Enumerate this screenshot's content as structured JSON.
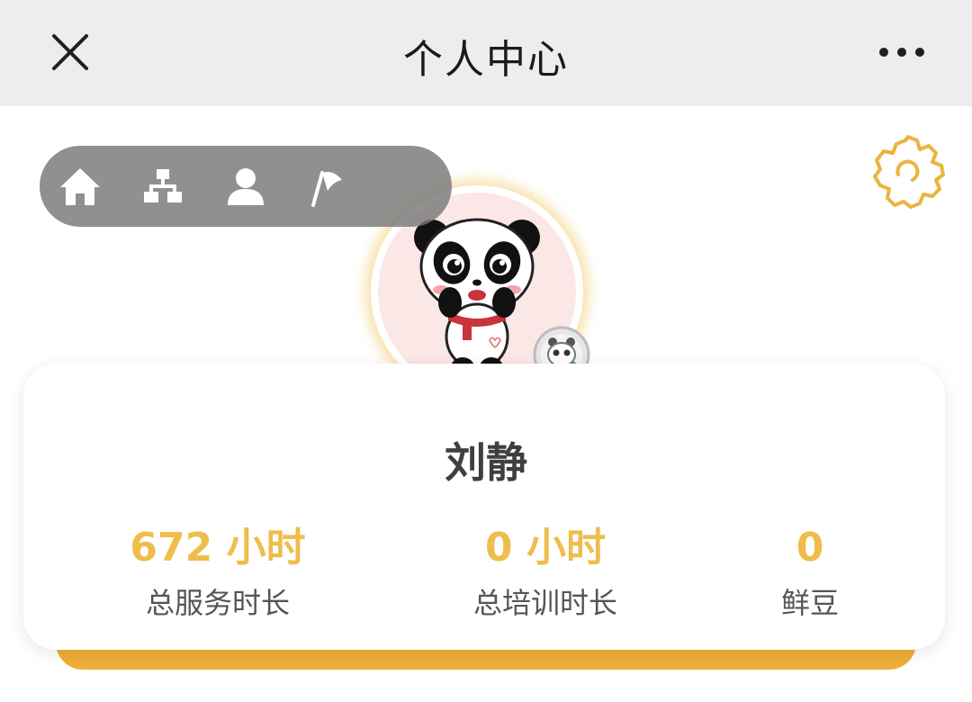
{
  "header": {
    "title": "个人中心",
    "close_icon": "close-icon",
    "more_icon": "more-dots-icon"
  },
  "nav": {
    "items": [
      {
        "icon": "home-icon"
      },
      {
        "icon": "sitemap-icon"
      },
      {
        "icon": "user-icon"
      },
      {
        "icon": "flag-icon"
      }
    ]
  },
  "settings": {
    "icon": "gear-icon"
  },
  "profile": {
    "name": "刘静",
    "avatar": "panda-avatar",
    "badge": "panda-medal-icon"
  },
  "stats": [
    {
      "value": "672 小时",
      "label": "总服务时长"
    },
    {
      "value": "0 小时",
      "label": "总培训时长"
    },
    {
      "value": "0",
      "label": "鲜豆"
    }
  ],
  "colors": {
    "accent": "#eebd4c",
    "card_bar": "#efae3a",
    "header_bg": "#ededed",
    "avatar_bg": "#fbe7e5"
  }
}
